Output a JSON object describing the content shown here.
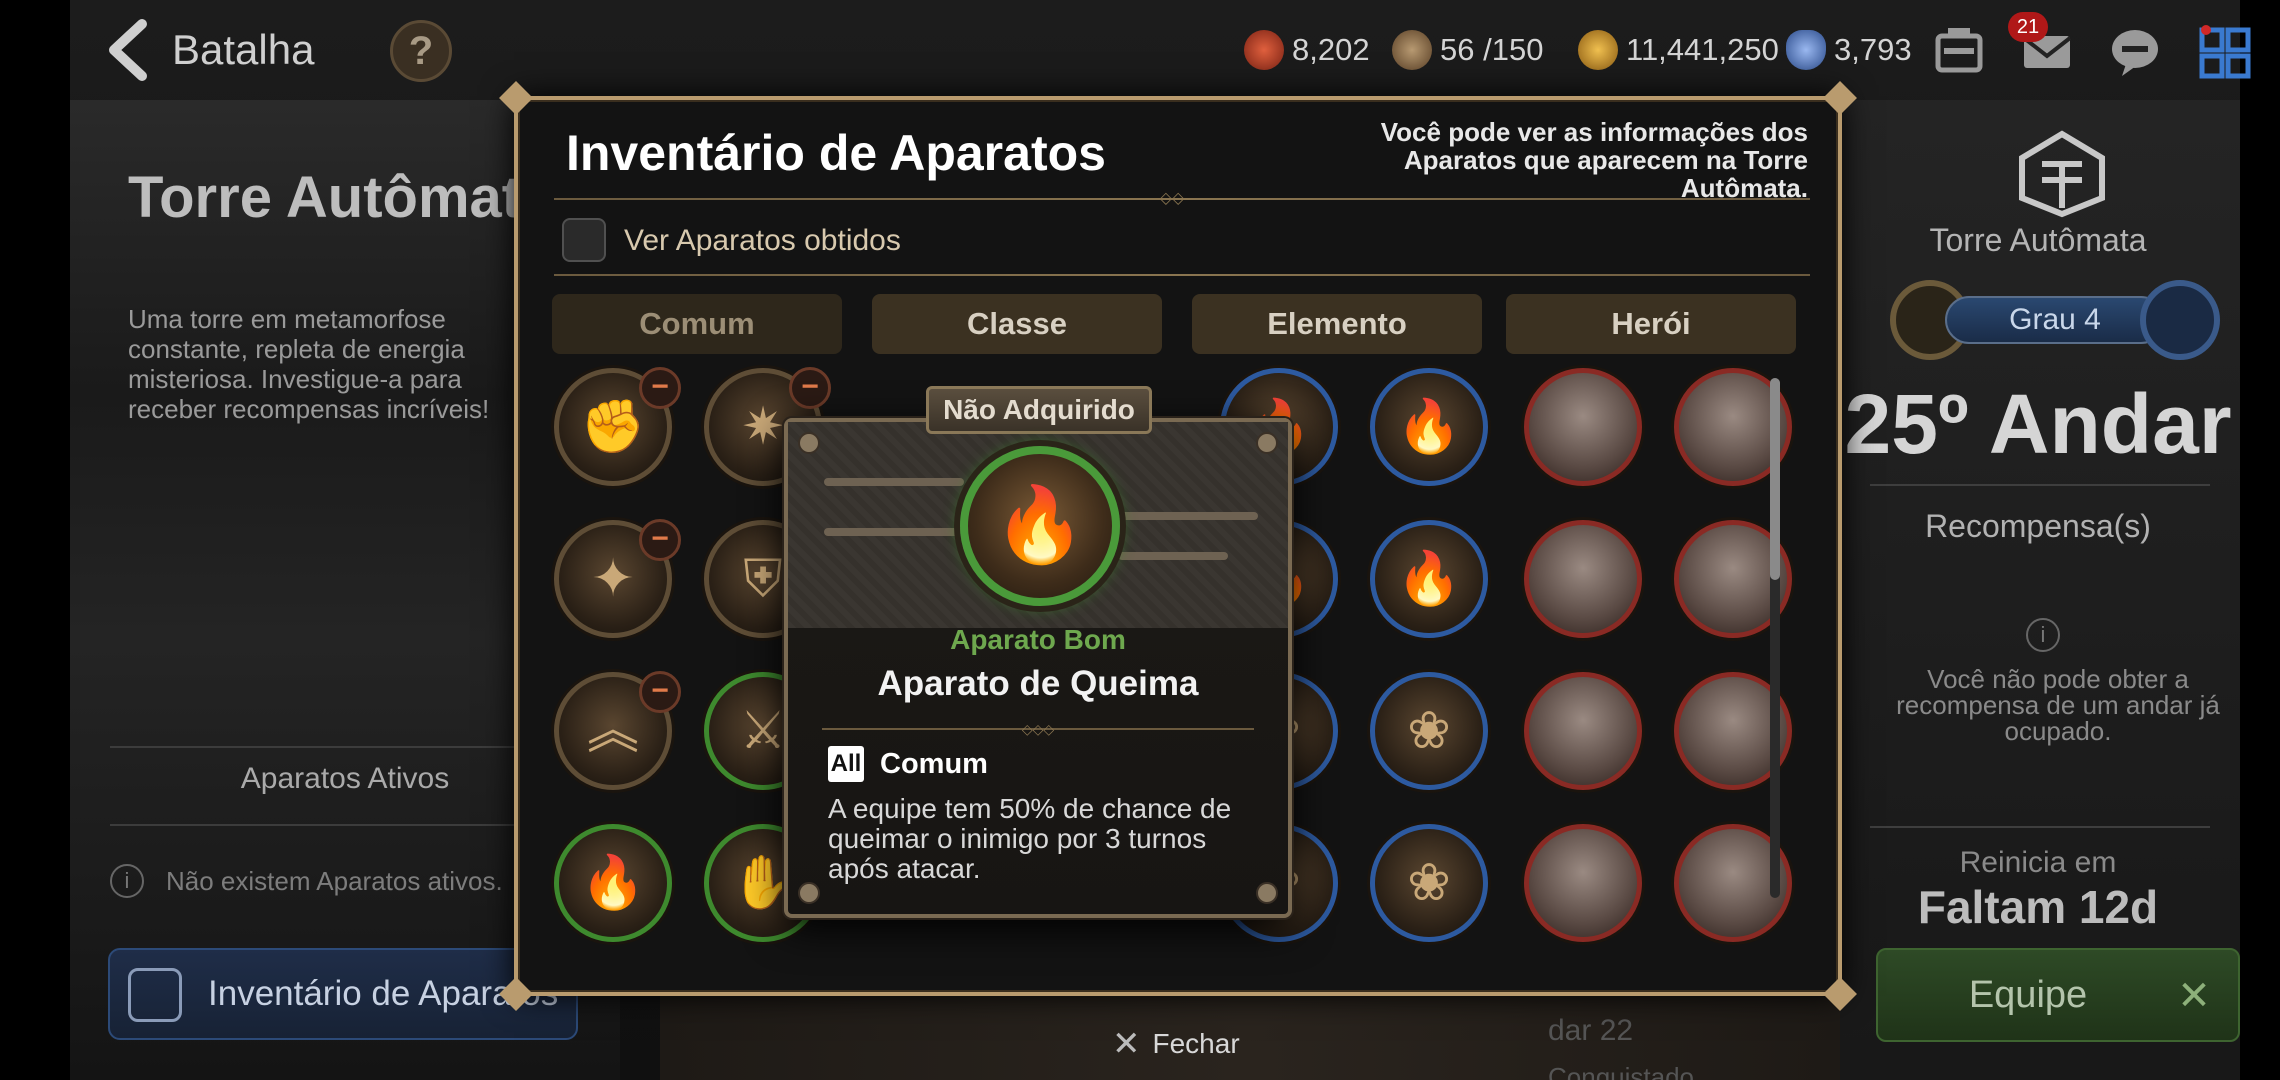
{
  "topbar": {
    "back_title": "Batalha",
    "help": "?",
    "resources": [
      {
        "icon": "stamina-icon",
        "value": "8,202",
        "color": "#c8452e"
      },
      {
        "icon": "coin-bag-icon",
        "value": "56 /150",
        "color": "#9a7a52"
      },
      {
        "icon": "gold-icon",
        "value": "11,441,250",
        "color": "#d6a030"
      },
      {
        "icon": "crystal-icon",
        "value": "3,793",
        "color": "#6a8ac8"
      }
    ],
    "mail_badge": "21"
  },
  "left_panel": {
    "title": "Torre Autômata",
    "description": "Uma torre em metamorfose constante, repleta de energia misteriosa. Investigue-a para receber recompensas incríveis!",
    "active_heading": "Aparatos Ativos",
    "no_active": "Não existem Aparatos ativos.",
    "inventory_button": "Inventário de Aparatos"
  },
  "right_panel": {
    "name": "Torre Autômata",
    "grau": "Grau 4",
    "floor": "25º Andar",
    "reward_heading": "Recompensa(s)",
    "reward_note": "Você não pode obter a recompensa de um andar já ocupado.",
    "reset_label": "Reinicia em",
    "reset_value": "Faltam 12d",
    "equipe": "Equipe",
    "bg_floor": "dar 22",
    "bg_status": "Conquistado"
  },
  "dialog": {
    "title": "Inventário de Aparatos",
    "subtitle": "Você pode ver as informações dos Aparatos que aparecem na Torre Autômata.",
    "checkbox_label": "Ver Aparatos obtidos",
    "tabs": [
      "Comum",
      "Classe",
      "Elemento",
      "Herói"
    ],
    "close": "Fechar"
  },
  "tooltip": {
    "tag": "Não Adquirido",
    "quality": "Aparato Bom",
    "name": "Aparato de Queima",
    "type_badge": "All",
    "type": "Comum",
    "description": "A equipe tem 50% de chance de queimar o inimigo por 3 turnos após atacar."
  }
}
